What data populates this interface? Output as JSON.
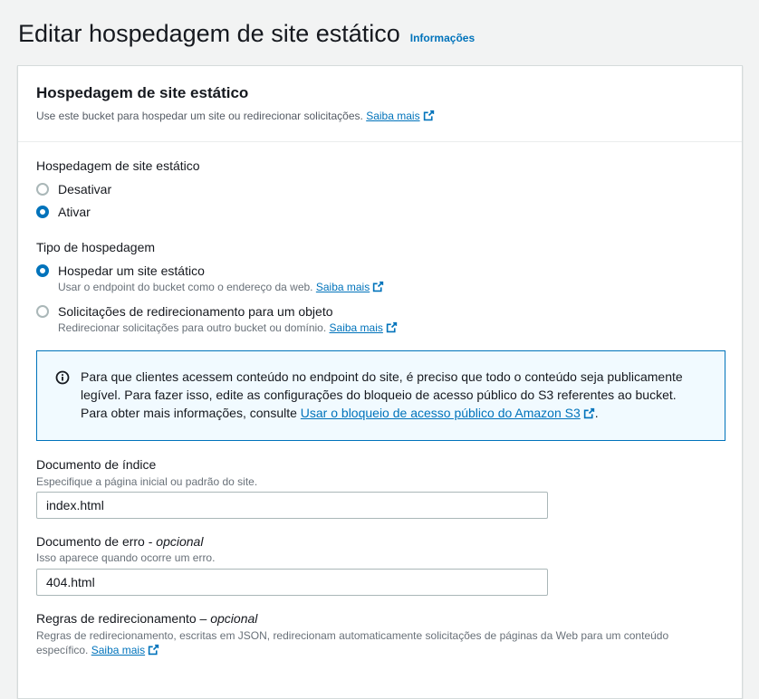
{
  "page": {
    "title": "Editar hospedagem de site estático",
    "info_link": "Informações"
  },
  "panel": {
    "title": "Hospedagem de site estático",
    "description": "Use este bucket para hospedar um site ou redirecionar solicitações.",
    "learn_more": "Saiba mais"
  },
  "hosting": {
    "label": "Hospedagem de site estático",
    "options": [
      {
        "label": "Desativar",
        "checked": false
      },
      {
        "label": "Ativar",
        "checked": true
      }
    ]
  },
  "hosting_type": {
    "label": "Tipo de hospedagem",
    "options": [
      {
        "label": "Hospedar um site estático",
        "description": "Usar o endpoint do bucket como o endereço da web.",
        "learn_more": "Saiba mais",
        "checked": true
      },
      {
        "label": "Solicitações de redirecionamento para um objeto",
        "description": "Redirecionar solicitações para outro bucket ou domínio.",
        "learn_more": "Saiba mais",
        "checked": false
      }
    ]
  },
  "alert": {
    "text": "Para que clientes acessem conteúdo no endpoint do site, é preciso que todo o conteúdo seja publicamente legível. Para fazer isso, edite as configurações do bloqueio de acesso público do S3 referentes ao bucket. Para obter mais informações, consulte ",
    "link": "Usar o bloqueio de acesso público do Amazon S3",
    "suffix": "."
  },
  "index_document": {
    "label": "Documento de índice",
    "description": "Especifique a página inicial ou padrão do site.",
    "value": "index.html"
  },
  "error_document": {
    "label": "Documento de erro - ",
    "optional": "opcional",
    "description": "Isso aparece quando ocorre um erro.",
    "value": "404.html"
  },
  "redirect_rules": {
    "label": "Regras de redirecionamento – ",
    "optional": "opcional",
    "description": "Regras de redirecionamento, escritas em JSON, redirecionam automaticamente solicitações de páginas da Web para um conteúdo específico.",
    "learn_more": "Saiba mais"
  },
  "colors": {
    "accent": "#0073bb",
    "alert_bg": "#f1faff",
    "page_bg": "#f2f3f3"
  },
  "icons": {
    "external": "external-link-icon",
    "info": "info-circle-icon"
  }
}
